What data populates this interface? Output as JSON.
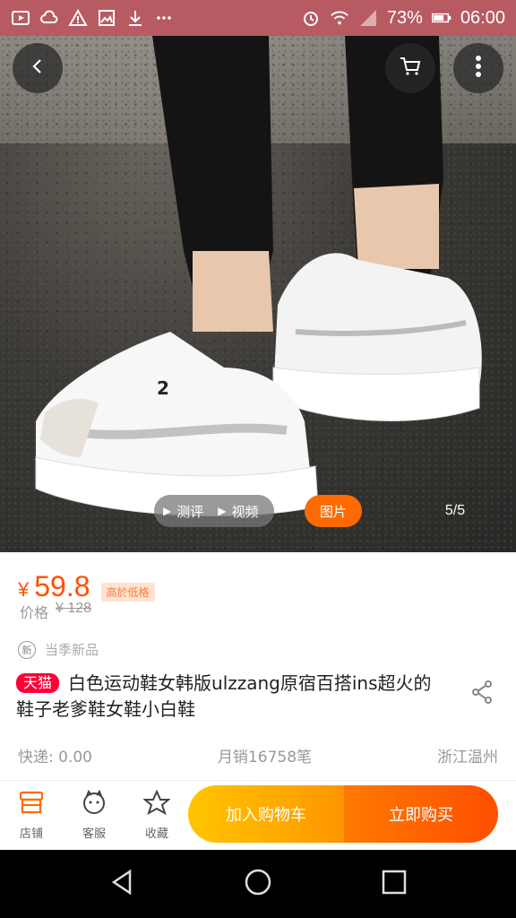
{
  "status_bar": {
    "battery": "73%",
    "time": "06:00"
  },
  "gallery": {
    "media_video": "测评",
    "media_live": "视频",
    "image_tab": "图片",
    "counter": "5/5"
  },
  "product": {
    "currency": "¥",
    "price": "59.8",
    "price_tag": "高於低格",
    "original_label": "价格",
    "original_price": "¥ 128",
    "new_badge": "新",
    "new_text": "当季新品",
    "tmall_label": "天猫",
    "title": "白色运动鞋女韩版ulzzang原宿百搭ins超火的鞋子老爹鞋女鞋小白鞋",
    "shipping": "快递: 0.00",
    "monthly_sales": "月销16758笔",
    "location": "浙江温州"
  },
  "action_bar": {
    "shop": "店铺",
    "service": "客服",
    "favorite": "收藏",
    "add_to_cart": "加入购物车",
    "buy_now": "立即购买"
  },
  "colors": {
    "accent": "#ff5000",
    "status_bar": "#b85a62",
    "tmall": "#ff0036"
  },
  "icons": [
    "back-arrow-icon",
    "cart-icon",
    "more-icon",
    "share-icon",
    "shop-icon",
    "service-icon",
    "star-icon"
  ]
}
